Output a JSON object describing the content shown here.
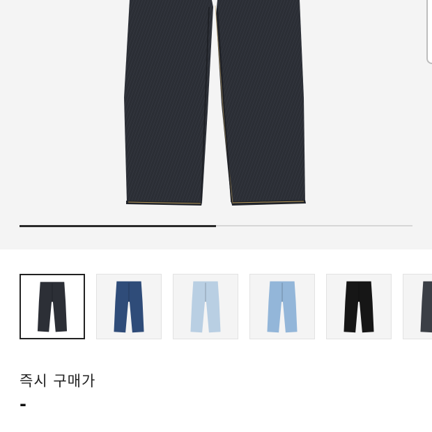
{
  "product": {
    "main_image_icon": "jeans-rinsed-denim",
    "gallery_progress": 0.5
  },
  "thumbnails": [
    {
      "icon": "jeans-dark-rinse",
      "color": "#2c2f36",
      "selected": true
    },
    {
      "icon": "jeans-blue",
      "color": "#2f4c79",
      "selected": false
    },
    {
      "icon": "jeans-light-bleached",
      "color": "#b9cfe3",
      "selected": false
    },
    {
      "icon": "jeans-light-blue",
      "color": "#93b6d9",
      "selected": false
    },
    {
      "icon": "jeans-black",
      "color": "#161616",
      "selected": false
    },
    {
      "icon": "jeans-grey",
      "color": "#3b3f46",
      "selected": false
    }
  ],
  "purchase": {
    "label": "즉시 구매가",
    "price": "-"
  }
}
